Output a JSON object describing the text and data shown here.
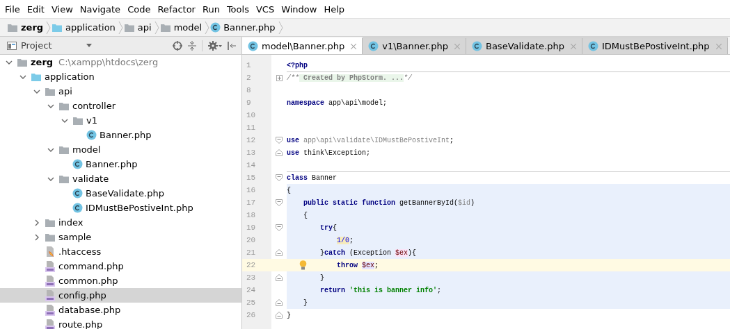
{
  "menu": [
    "File",
    "Edit",
    "View",
    "Navigate",
    "Code",
    "Refactor",
    "Run",
    "Tools",
    "VCS",
    "Window",
    "Help"
  ],
  "breadcrumbs": [
    {
      "label": "zerg",
      "kind": "root"
    },
    {
      "label": "application",
      "kind": "source-folder"
    },
    {
      "label": "api",
      "kind": "folder"
    },
    {
      "label": "model",
      "kind": "folder"
    },
    {
      "label": "Banner.php",
      "kind": "class"
    }
  ],
  "project_panel": {
    "title": "Project"
  },
  "editor_tabs": [
    {
      "label": "model\\Banner.php",
      "selected": true
    },
    {
      "label": "v1\\Banner.php",
      "selected": false
    },
    {
      "label": "BaseValidate.php",
      "selected": false
    },
    {
      "label": "IDMustBePostiveInt.php",
      "selected": false
    }
  ],
  "tree": [
    {
      "label": "zerg",
      "path": "C:\\xampp\\htdocs\\zerg",
      "kind": "root",
      "expanded": true,
      "selected": false,
      "children": [
        {
          "label": "application",
          "kind": "source-folder",
          "expanded": true,
          "selected": false,
          "children": [
            {
              "label": "api",
              "kind": "folder",
              "expanded": true,
              "selected": false,
              "children": [
                {
                  "label": "controller",
                  "kind": "folder",
                  "expanded": true,
                  "selected": false,
                  "children": [
                    {
                      "label": "v1",
                      "kind": "folder",
                      "expanded": true,
                      "selected": false,
                      "children": [
                        {
                          "label": "Banner.php",
                          "kind": "class",
                          "selected": false
                        }
                      ]
                    }
                  ]
                },
                {
                  "label": "model",
                  "kind": "folder",
                  "expanded": true,
                  "selected": false,
                  "children": [
                    {
                      "label": "Banner.php",
                      "kind": "class",
                      "selected": false
                    }
                  ]
                },
                {
                  "label": "validate",
                  "kind": "folder",
                  "expanded": true,
                  "selected": false,
                  "children": [
                    {
                      "label": "BaseValidate.php",
                      "kind": "class",
                      "selected": false
                    },
                    {
                      "label": "IDMustBePostiveInt.php",
                      "kind": "class",
                      "selected": false
                    }
                  ]
                }
              ]
            },
            {
              "label": "index",
              "kind": "folder",
              "expanded": false,
              "selected": false
            },
            {
              "label": "sample",
              "kind": "folder",
              "expanded": false,
              "selected": false
            },
            {
              "label": ".htaccess",
              "kind": "config",
              "selected": false
            },
            {
              "label": "command.php",
              "kind": "php",
              "selected": false
            },
            {
              "label": "common.php",
              "kind": "php",
              "selected": false
            },
            {
              "label": "config.php",
              "kind": "php",
              "selected": true
            },
            {
              "label": "database.php",
              "kind": "php",
              "selected": false
            },
            {
              "label": "route.php",
              "kind": "php",
              "selected": false
            }
          ]
        }
      ]
    }
  ],
  "code": [
    {
      "number": "1",
      "tokens": [
        {
          "kind": "keyword",
          "text": "<?php"
        }
      ]
    },
    {
      "number": "2",
      "folded": true,
      "separator": true,
      "tokens": [
        {
          "kind": "comment",
          "text": "/**"
        },
        {
          "kind": "folded",
          "text": " Created by PhpStorm. ..."
        },
        {
          "kind": "comment",
          "text": "*/"
        }
      ]
    },
    {
      "number": "8"
    },
    {
      "number": "9",
      "tokens": [
        {
          "kind": "keyword",
          "text": "namespace"
        },
        {
          "kind": "plain",
          "text": " app\\api\\model;"
        }
      ]
    },
    {
      "number": "10"
    },
    {
      "number": "11"
    },
    {
      "number": "12",
      "fold_start": true,
      "tokens": [
        {
          "kind": "keyword",
          "text": "use"
        },
        {
          "kind": "unused",
          "text": " app\\api\\validate\\IDMustBePostiveInt"
        },
        {
          "kind": "plain",
          "text": ";"
        }
      ]
    },
    {
      "number": "13",
      "fold_end": true,
      "tokens": [
        {
          "kind": "keyword",
          "text": "use"
        },
        {
          "kind": "plain",
          "text": " think\\Exception;"
        }
      ]
    },
    {
      "number": "14"
    },
    {
      "number": "15",
      "fold_start": true,
      "separator": true,
      "tokens": [
        {
          "kind": "keyword",
          "text": "class"
        },
        {
          "kind": "plain",
          "text": " Banner"
        }
      ]
    },
    {
      "number": "16",
      "scope": true,
      "tokens": [
        {
          "kind": "plain",
          "text": "{"
        }
      ],
      "children": [
        {
          "number": "17",
          "fold_start": true,
          "scope": true,
          "tokens": [
            {
              "kind": "keyword",
              "text": "public static function"
            },
            {
              "kind": "plain",
              "text": " getBannerById("
            },
            {
              "kind": "unused",
              "text": "$id"
            },
            {
              "kind": "plain",
              "text": ")"
            }
          ]
        },
        {
          "number": "18",
          "scope": true,
          "tokens": [
            {
              "kind": "plain",
              "text": "{"
            }
          ],
          "children": [
            {
              "number": "19",
              "fold_start": true,
              "scope": true,
              "tokens": [
                {
                  "kind": "keyword",
                  "text": "try"
                },
                {
                  "kind": "plain",
                  "text": "{"
                }
              ],
              "children": [
                {
                  "number": "20",
                  "scope": true,
                  "tokens": [
                    {
                      "kind": "number",
                      "text": "1/0",
                      "warning": true
                    },
                    {
                      "kind": "plain",
                      "text": ";"
                    }
                  ]
                }
              ]
            },
            {
              "number": "21",
              "fold_end": true,
              "scope": true,
              "tokens": [
                {
                  "kind": "plain",
                  "text": "}"
                },
                {
                  "kind": "keyword",
                  "text": "catch"
                },
                {
                  "kind": "plain",
                  "text": " (Exception "
                },
                {
                  "kind": "variable",
                  "text": "$ex",
                  "write_usage": true
                },
                {
                  "kind": "plain",
                  "text": "){"
                }
              ],
              "children": [
                {
                  "number": "22",
                  "current": true,
                  "intention": true,
                  "tokens": [
                    {
                      "kind": "keyword",
                      "text": "throw "
                    },
                    {
                      "kind": "variable",
                      "text": "$ex",
                      "read_usage": true
                    },
                    {
                      "kind": "plain",
                      "text": ";"
                    }
                  ]
                }
              ]
            },
            {
              "number": "23",
              "fold_end": true,
              "scope": true,
              "tokens": [
                {
                  "kind": "plain",
                  "text": "}"
                }
              ]
            },
            {
              "number": "24",
              "scope": true,
              "tokens": [
                {
                  "kind": "keyword",
                  "text": "return"
                },
                {
                  "kind": "string",
                  "text": " 'this is banner info'"
                },
                {
                  "kind": "plain",
                  "text": ";"
                }
              ]
            }
          ]
        },
        {
          "number": "25",
          "fold_end": true,
          "scope": true,
          "tokens": [
            {
              "kind": "plain",
              "text": "}"
            }
          ]
        }
      ]
    },
    {
      "number": "26",
      "fold_end": true,
      "tokens": [
        {
          "kind": "plain",
          "text": "}"
        }
      ]
    }
  ]
}
